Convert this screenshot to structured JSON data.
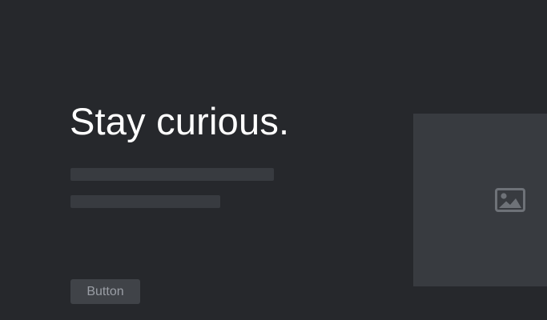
{
  "hero": {
    "headline": "Stay curious.",
    "button_label": "Button",
    "image_icon": "image-icon"
  },
  "colors": {
    "background": "#26282c",
    "headline": "#ffffff",
    "placeholder": "#383b40",
    "button_bg": "#404348",
    "button_text": "#9a9ea5",
    "icon": "#6e7278"
  }
}
